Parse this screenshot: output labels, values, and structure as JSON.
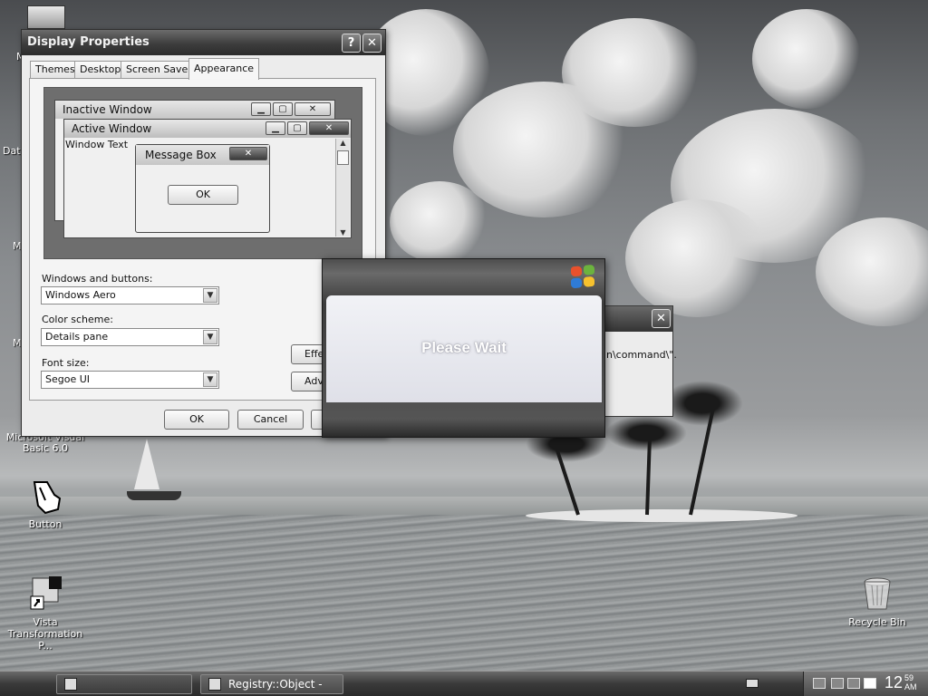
{
  "display_properties": {
    "title": "Display Properties",
    "help_button": "?",
    "close_button": "✕",
    "tabs": [
      {
        "label": "Themes"
      },
      {
        "label": "Desktop"
      },
      {
        "label": "Screen Saver"
      },
      {
        "label": "Appearance",
        "active": true
      }
    ],
    "preview": {
      "inactive_title": "Inactive Window",
      "active_title": "Active Window",
      "window_text": "Window Text",
      "message_box_title": "Message Box",
      "ok_label": "OK"
    },
    "windows_and_buttons": {
      "label": "Windows and buttons:",
      "value": "Windows Aero"
    },
    "color_scheme": {
      "label": "Color scheme:",
      "value": "Details pane"
    },
    "font_size": {
      "label": "Font size:",
      "value": "Segoe UI"
    },
    "effects_label": "Effe",
    "advanced_label": "Adv",
    "ok_label": "OK",
    "cancel_label": "Cancel"
  },
  "wait_dialog": {
    "message": "Please Wait"
  },
  "error_window": {
    "partial_text": "n\\command\\\"."
  },
  "desktop_icons": {
    "vb_line1": "Microsoft Visual",
    "vb_line2": "Basic 6.0",
    "button": "Button",
    "vista_line1": "Vista",
    "vista_line2": "Transformation P...",
    "recycle_bin": "Recycle Bin",
    "edge_m1": "M",
    "edge_data": "Data",
    "edge_m2": "M",
    "edge_m3": "M"
  },
  "taskbar": {
    "task_active": "Registry::Object - Error",
    "clock_hour": "12",
    "clock_minutes": "59",
    "clock_ampm": "AM"
  }
}
